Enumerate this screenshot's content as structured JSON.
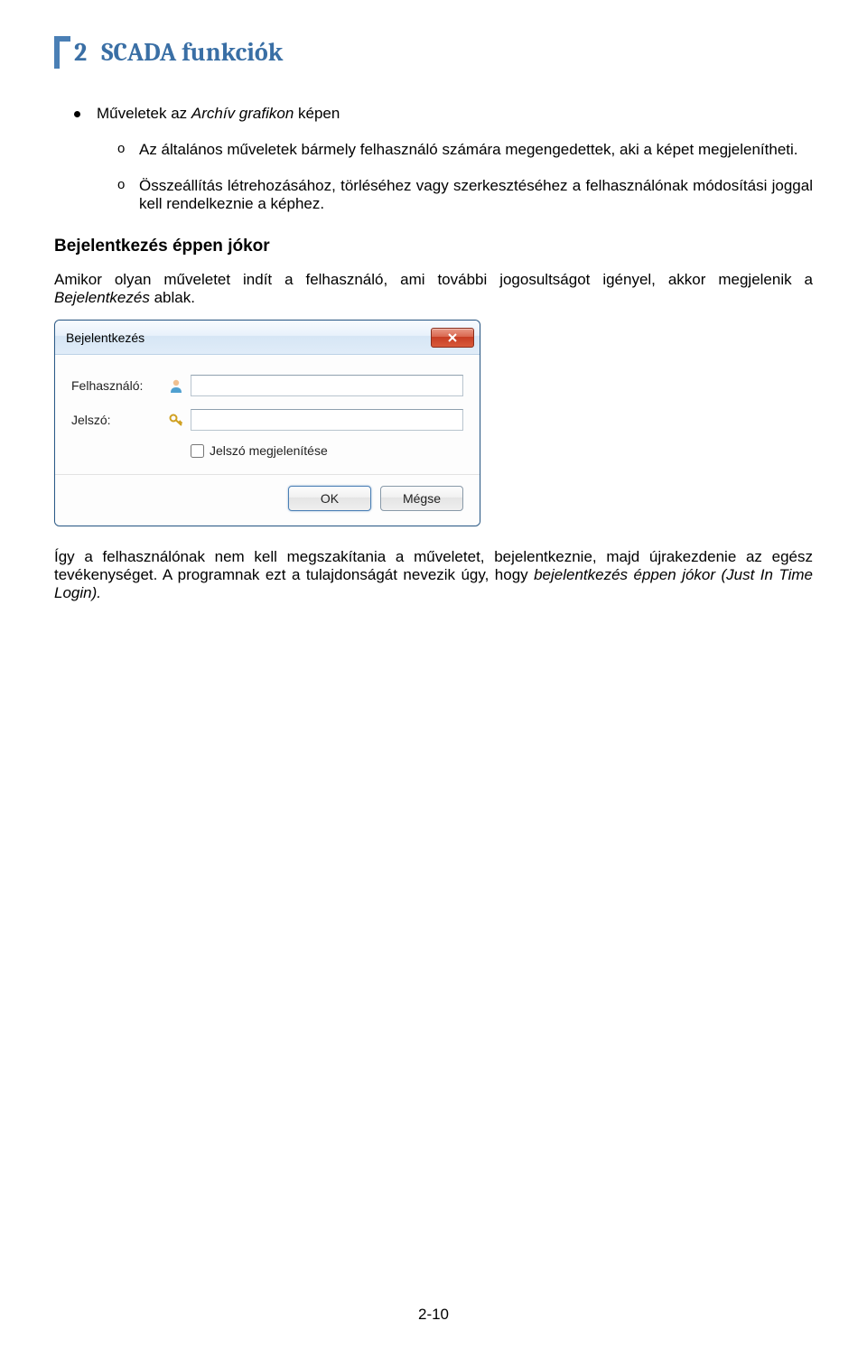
{
  "header": {
    "chapter_number": "2",
    "chapter_title": "SCADA funkciók"
  },
  "bullet": {
    "label_prefix": "Műveletek az ",
    "label_italic": "Archív grafikon",
    "label_suffix": " képen"
  },
  "sub_items": [
    "Az általános műveletek bármely felhasználó számára megengedettek, aki a képet megjelenítheti.",
    "Összeállítás létrehozásához, törléséhez vagy szerkesztéséhez a felhasználónak módosítási joggal kell rendelkeznie a képhez."
  ],
  "sub_marker": "o",
  "section_heading": "Bejelentkezés éppen jókor",
  "para1_prefix": "Amikor olyan műveletet indít a felhasználó, ami további jogosultságot igényel, akkor megjelenik a ",
  "para1_italic": "Bejelentkezés",
  "para1_suffix": " ablak.",
  "dialog": {
    "title": "Bejelentkezés",
    "user_label": "Felhasználó:",
    "pass_label": "Jelszó:",
    "show_pass_label": "Jelszó megjelenítése",
    "ok_label": "OK",
    "cancel_label": "Mégse",
    "user_value": "",
    "pass_value": ""
  },
  "para2_prefix": "Így a felhasználónak nem kell megszakítania a műveletet, bejelentkeznie, majd újrakezdenie az egész tevékenységet. A programnak ezt a tulajdonságát nevezik úgy, hogy ",
  "para2_italic": "bejelentkezés éppen jókor (Just In Time Login).",
  "page_number": "2-10"
}
